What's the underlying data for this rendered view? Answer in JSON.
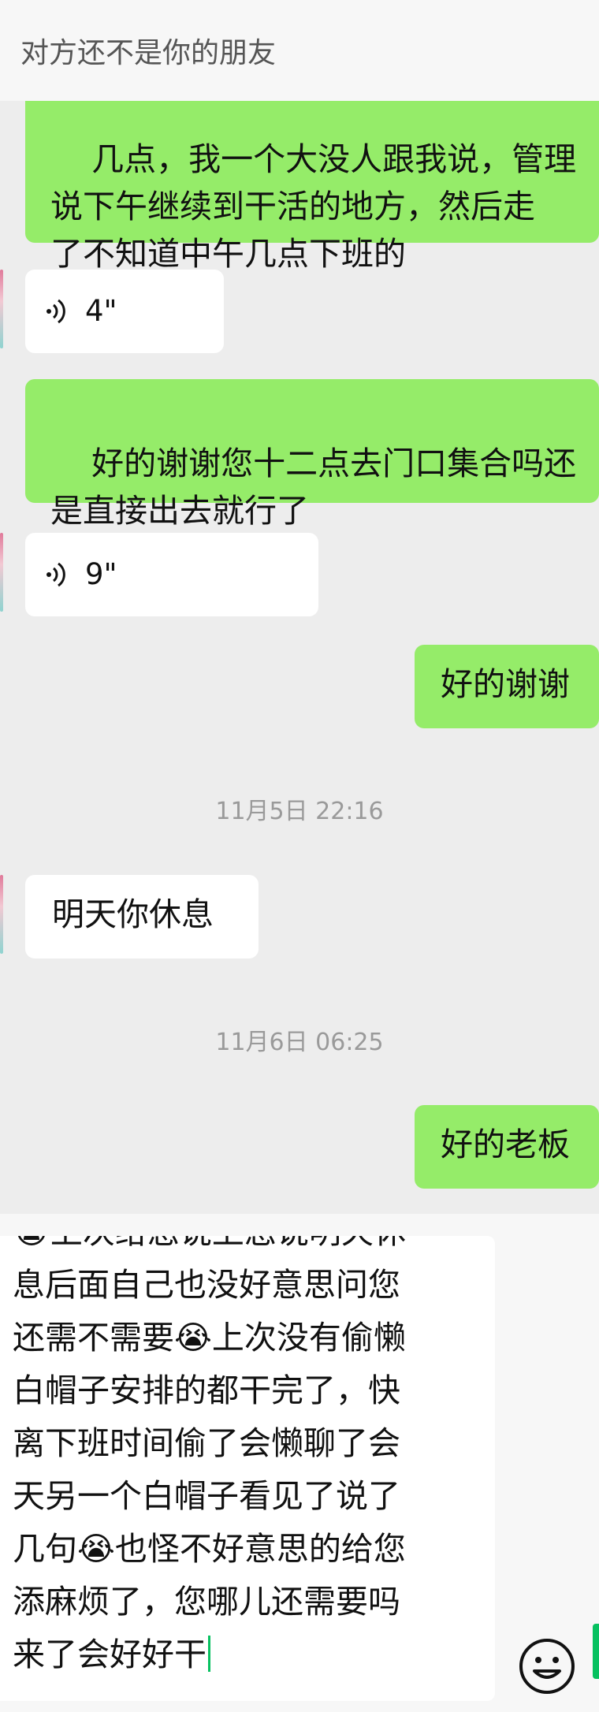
{
  "header": {
    "title": "对方还不是你的朋友"
  },
  "messages": {
    "m1": {
      "text": "几点，我一个大没人跟我说，管理\n说下午继续到干活的地方，然后走\n了不知道中午几点下班的"
    },
    "m2": {
      "duration": "4\""
    },
    "m3": {
      "text": "好的谢谢您十二点去门口集合吗还\n是直接出去就行了"
    },
    "m4": {
      "duration": "9\""
    },
    "m5": {
      "text": "好的谢谢"
    },
    "ts1": "11月5日 22:16",
    "m6": {
      "text": "明天你休息"
    },
    "ts2": "11月6日 06:25",
    "m7": {
      "text": "好的老板"
    }
  },
  "composer": {
    "draft": "😭上次给您说上您说明天休\n息后面自己也没好意思问您\n还需不需要😭上次没有偷懒\n白帽子安排的都干完了，快\n离下班时间偷了会懒聊了会\n天另一个白帽子看见了说了\n几句😭也怪不好意思的给您\n添麻烦了，您哪儿还需要吗\n来了会好好干"
  },
  "colors": {
    "outgoing_bubble": "#95ec69",
    "incoming_bubble": "#ffffff",
    "background": "#ededed",
    "caret": "#07c160"
  },
  "icons": {
    "voice": "voice-wave-icon",
    "emoji": "emoji-smile-icon"
  }
}
